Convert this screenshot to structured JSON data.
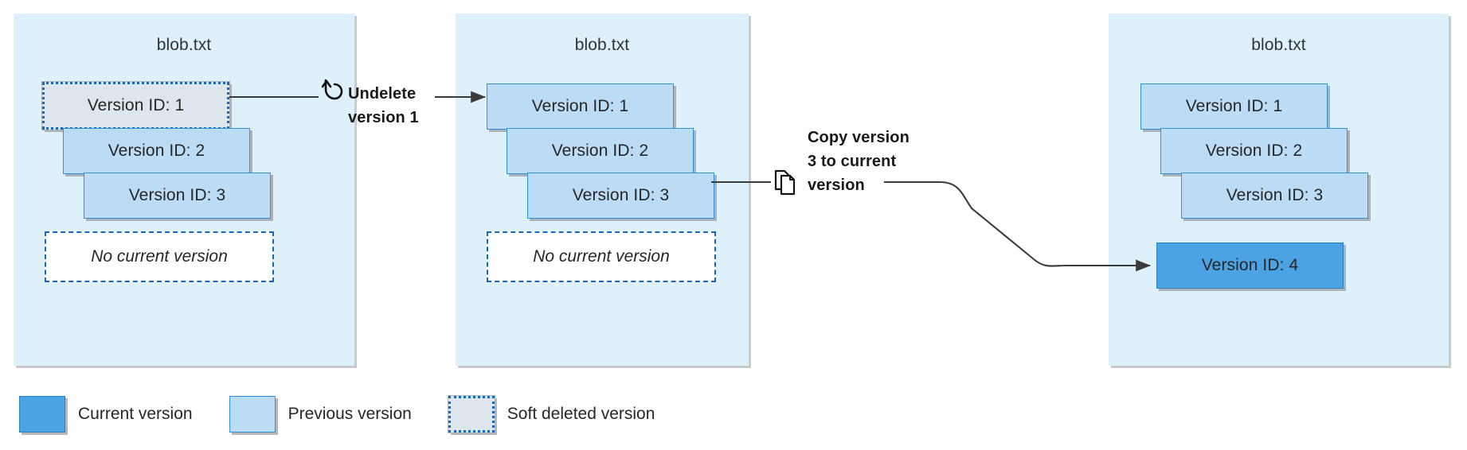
{
  "diagram": {
    "title_text": "blob.txt",
    "colors": {
      "panel_background": "#def0fa",
      "previous_version_fill": "#bcdcf6",
      "previous_version_border": "#2b93dd",
      "current_version_fill": "#4ba3e3",
      "current_version_border": "#2b7fc4",
      "soft_deleted_fill": "#dde6ec",
      "soft_deleted_border": "#1668c1",
      "connector_stroke": "#3b3b3b",
      "text": "#262626"
    },
    "panels": [
      {
        "id": "panel-1",
        "title": "blob.txt",
        "versions": [
          {
            "label": "Version ID: 1",
            "state": "soft-deleted"
          },
          {
            "label": "Version ID: 2",
            "state": "previous"
          },
          {
            "label": "Version ID: 3",
            "state": "previous"
          }
        ],
        "placeholder": "No current version"
      },
      {
        "id": "panel-2",
        "title": "blob.txt",
        "versions": [
          {
            "label": "Version ID: 1",
            "state": "previous"
          },
          {
            "label": "Version ID: 2",
            "state": "previous"
          },
          {
            "label": "Version ID: 3",
            "state": "previous"
          }
        ],
        "placeholder": "No current version"
      },
      {
        "id": "panel-3",
        "title": "blob.txt",
        "versions": [
          {
            "label": "Version ID: 1",
            "state": "previous"
          },
          {
            "label": "Version ID: 2",
            "state": "previous"
          },
          {
            "label": "Version ID: 3",
            "state": "previous"
          },
          {
            "label": "Version ID: 4",
            "state": "current"
          }
        ],
        "placeholder": null
      }
    ],
    "steps": [
      {
        "id": "step-undelete",
        "line1": "Undelete",
        "line2": "version 1",
        "icon": "undo-arrow-icon"
      },
      {
        "id": "step-copy",
        "line1": "Copy version",
        "line2": "3 to current",
        "line3": "version",
        "icon": "copy-icon"
      }
    ],
    "legend": {
      "items": [
        {
          "label": "Current version",
          "swatch": "current"
        },
        {
          "label": "Previous version",
          "swatch": "previous"
        },
        {
          "label": "Soft deleted version",
          "swatch": "deleted"
        }
      ]
    }
  }
}
